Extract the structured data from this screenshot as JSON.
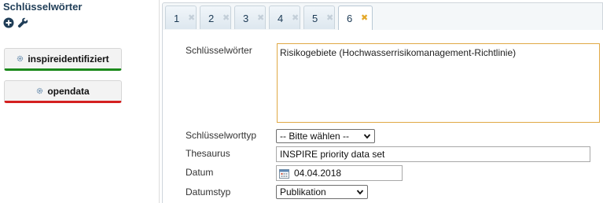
{
  "sidebar": {
    "title": "Schlüsselwörter",
    "tags": [
      {
        "label": "inspireidentifiziert",
        "status_color": "#1c8a1c"
      },
      {
        "label": "opendata",
        "status_color": "#d42020"
      }
    ]
  },
  "tabs": [
    {
      "label": "1",
      "close": "✖"
    },
    {
      "label": "2",
      "close": "✖"
    },
    {
      "label": "3",
      "close": "✖"
    },
    {
      "label": "4",
      "close": "✖"
    },
    {
      "label": "5",
      "close": "✖"
    },
    {
      "label": "6",
      "close": "✖",
      "active": true
    }
  ],
  "form": {
    "keywords_label": "Schlüsselwörter",
    "keywords_value": "Risikogebiete (Hochwasserrisikomanagement-Richtlinie)",
    "keyword_type_label": "Schlüsselworttyp",
    "keyword_type_value": "-- Bitte wählen --",
    "thesaurus_label": "Thesaurus",
    "thesaurus_value": "INSPIRE priority data set",
    "date_label": "Datum",
    "date_value": "04.04.2018",
    "date_type_label": "Datumstyp",
    "date_type_value": "Publikation"
  },
  "icons": {
    "add": "plus-circle-icon",
    "tools": "wrench-icon",
    "tag": "gear-icon",
    "calendar": "calendar-icon"
  },
  "colors": {
    "accent": "#1f3d57",
    "active_tab_close": "#e4a828",
    "textarea_border": "#e0a845"
  }
}
